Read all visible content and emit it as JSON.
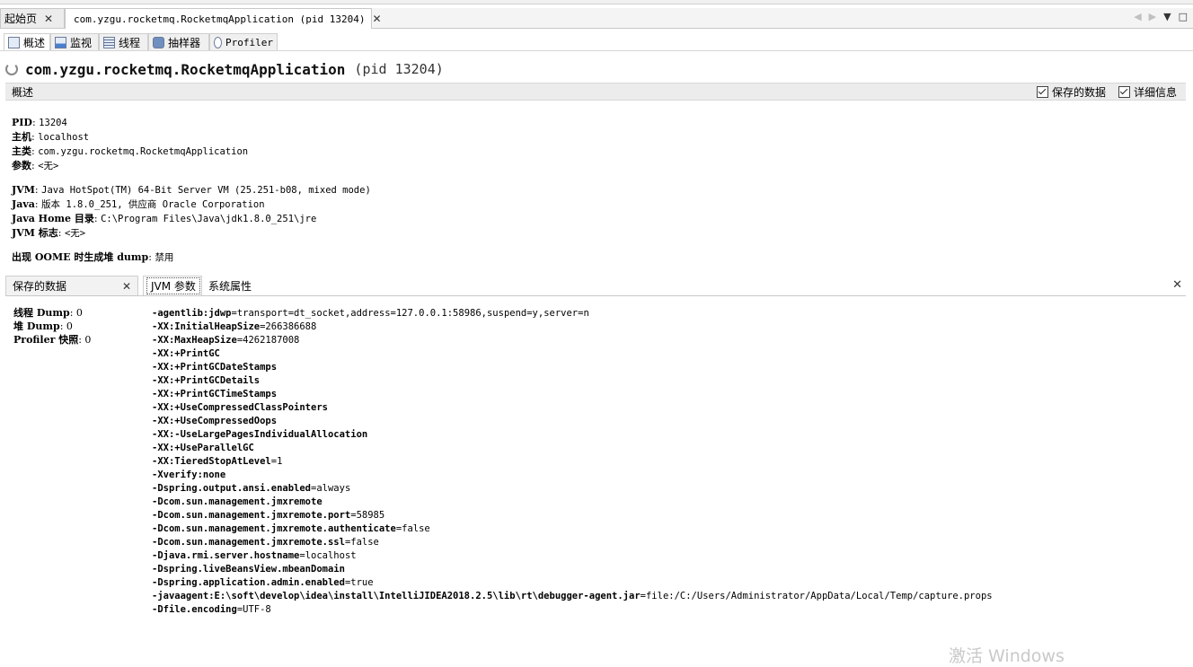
{
  "doc_tabs": [
    {
      "label": "起始页",
      "close": "✕"
    },
    {
      "label": "com.yzgu.rocketmq.RocketmqApplication (pid 13204)",
      "close": "✕"
    }
  ],
  "window_controls": {
    "left": "◀",
    "right": "▶",
    "menu": "▼",
    "maximize": "□"
  },
  "view_tabs": [
    {
      "label": "概述",
      "icon": "overview-icon"
    },
    {
      "label": "监视",
      "icon": "monitor-icon"
    },
    {
      "label": "线程",
      "icon": "threads-icon"
    },
    {
      "label": "抽样器",
      "icon": "sampler-icon"
    },
    {
      "label": "Profiler",
      "icon": "profiler-icon"
    }
  ],
  "app": {
    "name": "com.yzgu.rocketmq.RocketmqApplication",
    "pid": "(pid 13204)"
  },
  "overview": {
    "title": "概述",
    "checkbox_saved": "保存的数据",
    "checkbox_details": "详细信息"
  },
  "info": {
    "pid_label": "PID",
    "pid_value": "13204",
    "host_label": "主机",
    "host_value": "localhost",
    "main_class_label": "主类",
    "main_class_value": "com.yzgu.rocketmq.RocketmqApplication",
    "args_label": "参数",
    "args_value": "<无>",
    "jvm_label": "JVM",
    "jvm_value": "Java HotSpot(TM) 64-Bit Server VM (25.251-b08, mixed mode)",
    "java_label": "Java",
    "java_value": "版本 1.8.0_251, 供应商 Oracle Corporation",
    "java_home_label": "Java Home 目录",
    "java_home_value": "C:\\Program Files\\Java\\jdk1.8.0_251\\jre",
    "jvm_flags_label": "JVM 标志",
    "jvm_flags_value": "<无>",
    "oome_label": "出现 OOME 时生成堆 dump",
    "oome_value": "禁用"
  },
  "lower_tabs": {
    "saved_tab": "保存的数据",
    "saved_close": "✕",
    "jvm_args_tab": "JVM 参数",
    "sys_props_tab": "系统属性",
    "panel_close": "✕"
  },
  "saved_data": [
    {
      "label": "线程 Dump",
      "value": "0"
    },
    {
      "label": "堆 Dump",
      "value": "0"
    },
    {
      "label": "Profiler 快照",
      "value": "0"
    }
  ],
  "jvm_args": [
    {
      "k": "-agentlib:jdwp",
      "v": "=transport=dt_socket,address=127.0.0.1:58986,suspend=y,server=n"
    },
    {
      "k": "-XX:InitialHeapSize",
      "v": "=266386688"
    },
    {
      "k": "-XX:MaxHeapSize",
      "v": "=4262187008"
    },
    {
      "k": "-XX:+PrintGC",
      "v": ""
    },
    {
      "k": "-XX:+PrintGCDateStamps",
      "v": ""
    },
    {
      "k": "-XX:+PrintGCDetails",
      "v": ""
    },
    {
      "k": "-XX:+PrintGCTimeStamps",
      "v": ""
    },
    {
      "k": "-XX:+UseCompressedClassPointers",
      "v": ""
    },
    {
      "k": "-XX:+UseCompressedOops",
      "v": ""
    },
    {
      "k": "-XX:-UseLargePagesIndividualAllocation",
      "v": ""
    },
    {
      "k": "-XX:+UseParallelGC",
      "v": ""
    },
    {
      "k": "-XX:TieredStopAtLevel",
      "v": "=1"
    },
    {
      "k": "-Xverify:none",
      "v": ""
    },
    {
      "k": "-Dspring.output.ansi.enabled",
      "v": "=always"
    },
    {
      "k": "-Dcom.sun.management.jmxremote",
      "v": ""
    },
    {
      "k": "-Dcom.sun.management.jmxremote.port",
      "v": "=58985"
    },
    {
      "k": "-Dcom.sun.management.jmxremote.authenticate",
      "v": "=false"
    },
    {
      "k": "-Dcom.sun.management.jmxremote.ssl",
      "v": "=false"
    },
    {
      "k": "-Djava.rmi.server.hostname",
      "v": "=localhost"
    },
    {
      "k": "-Dspring.liveBeansView.mbeanDomain",
      "v": ""
    },
    {
      "k": "-Dspring.application.admin.enabled",
      "v": "=true"
    },
    {
      "k": "-javaagent:E:\\soft\\develop\\idea\\install\\IntelliJIDEA2018.2.5\\lib\\rt\\debugger-agent.jar",
      "v": "=file:/C:/Users/Administrator/AppData/Local/Temp/capture.props"
    },
    {
      "k": "-Dfile.encoding",
      "v": "=UTF-8"
    }
  ],
  "watermark": "激活 Windows"
}
